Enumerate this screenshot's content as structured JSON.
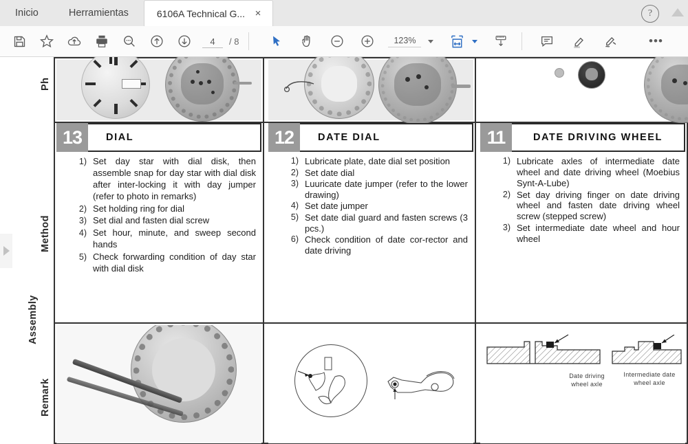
{
  "app": {
    "accent_color": "#2f6fc4",
    "tabs": [
      {
        "label": "Inicio",
        "type": "plain"
      },
      {
        "label": "Herramientas",
        "type": "plain"
      },
      {
        "label": "6106A Technical G...",
        "type": "document",
        "close": "×"
      }
    ],
    "help_icon_label": "?"
  },
  "toolbar": {
    "left_tools": [
      {
        "name": "save-icon",
        "title": "Guardar"
      },
      {
        "name": "star-icon",
        "title": "Añadir a favoritos"
      },
      {
        "name": "upload-cloud-icon",
        "title": "Enviar a la nube"
      },
      {
        "name": "print-icon",
        "title": "Imprimir"
      },
      {
        "name": "search-icon",
        "title": "Buscar"
      },
      {
        "name": "arrow-up-icon",
        "title": "Página anterior"
      },
      {
        "name": "arrow-down-icon",
        "title": "Página siguiente"
      }
    ],
    "page": {
      "current": "4",
      "separator": "/",
      "total": "8"
    },
    "right_tools": [
      {
        "name": "cursor-icon",
        "title": "Seleccionar"
      },
      {
        "name": "hand-icon",
        "title": "Mano"
      },
      {
        "name": "zoom-out-icon",
        "title": "Reducir"
      },
      {
        "name": "zoom-in-icon",
        "title": "Ampliar"
      }
    ],
    "zoom": {
      "value": "123%"
    },
    "fit_tool": {
      "name": "fit-width-icon",
      "title": "Ajustar al ancho"
    },
    "scroll_tool": {
      "name": "page-scroll-icon",
      "title": "Desplazamiento de página"
    },
    "annotate_tools": [
      {
        "name": "comment-icon",
        "title": "Comentario"
      },
      {
        "name": "highlight-icon",
        "title": "Resaltar"
      },
      {
        "name": "sign-icon",
        "title": "Firmar"
      }
    ],
    "more_label": "•••"
  },
  "document": {
    "row_labels": [
      {
        "key": "photo",
        "label": "Ph"
      },
      {
        "key": "method",
        "label": "Method"
      },
      {
        "key": "assembly",
        "label": "Assembly"
      },
      {
        "key": "remark",
        "label": "Remark"
      }
    ],
    "sections": [
      {
        "number": "13",
        "title": "DIAL",
        "steps": [
          {
            "n": "1)",
            "text": "Set day star with dial disk, then assemble snap for day star with dial disk after inter-locking it with day jumper (refer to photo in remarks)"
          },
          {
            "n": "2)",
            "text": "Set holding ring for dial"
          },
          {
            "n": "3)",
            "text": "Set dial and fasten dial screw"
          },
          {
            "n": "4)",
            "text": "Set hour, minute, and sweep second hands"
          },
          {
            "n": "5)",
            "text": "Check forwarding condition of day star with dial disk"
          }
        ]
      },
      {
        "number": "12",
        "title": "DATE DIAL",
        "steps": [
          {
            "n": "1)",
            "text": "Lubricate plate, date dial set position"
          },
          {
            "n": "2)",
            "text": "Set date dial"
          },
          {
            "n": "3)",
            "text": "Luuricate date jumper (refer to the lower drawing)"
          },
          {
            "n": "4)",
            "text": "Set date jumper"
          },
          {
            "n": "5)",
            "text": "Set date dial guard and fasten screws (3 pcs.)"
          },
          {
            "n": "6)",
            "text": "Check condition of date cor-rector and date driving"
          }
        ]
      },
      {
        "number": "11",
        "title": "DATE DRIVING WHEEL",
        "steps": [
          {
            "n": "1)",
            "text": "Lubricate axles of intermediate date wheel and date driving wheel (Moebius Synt-A-Lube)"
          },
          {
            "n": "2)",
            "text": "Set day driving finger on date driving wheel and fasten date driving wheel screw (stepped screw)"
          },
          {
            "n": "3)",
            "text": "Set intermediate date wheel and hour wheel"
          }
        ]
      }
    ],
    "remark_captions": [
      {
        "line1": "Date driving",
        "line2": "wheel axle"
      },
      {
        "line1": "Intermediate date",
        "line2": "wheel axle"
      }
    ]
  }
}
